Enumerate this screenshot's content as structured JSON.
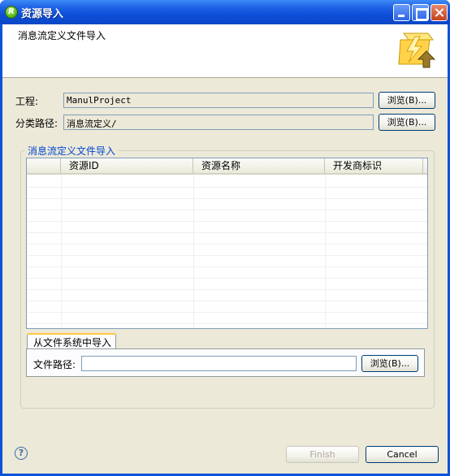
{
  "window": {
    "title": "资源导入",
    "app_icon_letter": "R"
  },
  "banner": {
    "title": "消息流定义文件导入",
    "icon": "import-wizard-icon"
  },
  "form": {
    "project_label": "工程:",
    "project_value": "ManulProject",
    "path_label": "分类路径:",
    "path_value": "消息流定义/",
    "browse_label": "浏览(B)..."
  },
  "group": {
    "legend": "消息流定义文件导入",
    "columns": [
      "",
      "资源ID",
      "资源名称",
      "开发商标识"
    ]
  },
  "tab": {
    "label": "从文件系统中导入",
    "file_path_label": "文件路径:",
    "file_path_value": "",
    "browse_label": "浏览(B)..."
  },
  "footer": {
    "help_icon": "help-icon",
    "finish_label": "Finish",
    "cancel_label": "Cancel"
  },
  "colors": {
    "titlebar": "#0d4fd8",
    "dialog_bg": "#ece9d8",
    "legend_text": "#0046d5",
    "tab_highlight": "#ffc83c"
  }
}
